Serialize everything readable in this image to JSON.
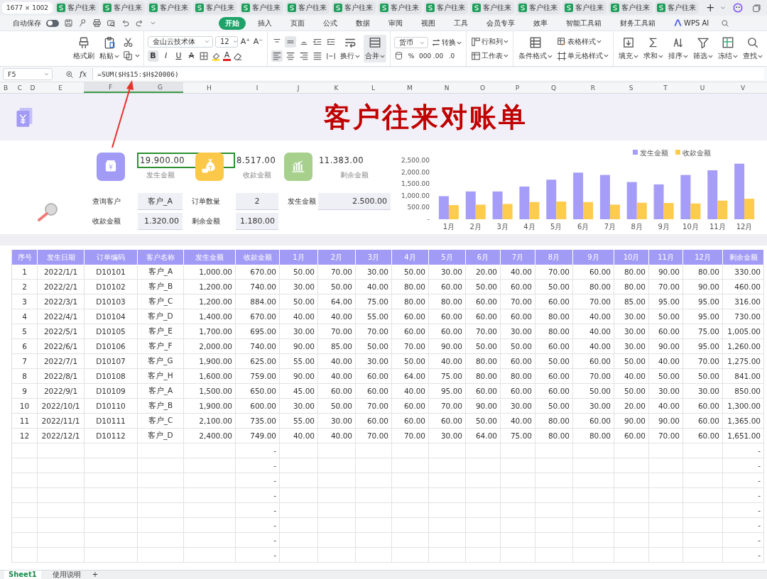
{
  "window_size_badge": "1677 × 1002",
  "doc_tabs": [
    {
      "label": "客户往来",
      "selected": false
    },
    {
      "label": "客户往来",
      "selected": false
    },
    {
      "label": "客户往来",
      "selected": false
    },
    {
      "label": "客户往来",
      "selected": false
    },
    {
      "label": "客户往来",
      "selected": false
    },
    {
      "label": "客户往来",
      "selected": false
    },
    {
      "label": "客户往来",
      "selected": false
    },
    {
      "label": "客户往来",
      "selected": false
    },
    {
      "label": "客户往来",
      "selected": false
    },
    {
      "label": "客户往来",
      "selected": false
    },
    {
      "label": "客户往来",
      "selected": false
    },
    {
      "label": "客户往来",
      "selected": false
    },
    {
      "label": "客户往来",
      "selected": false
    },
    {
      "label": "客户往来",
      "selected": false
    }
  ],
  "new_tab": "+",
  "quick_access": {
    "autosave_label": "自动保存",
    "autosave_on": false
  },
  "menu_tabs": [
    {
      "label": "开始",
      "selected": true,
      "kind": "text"
    },
    {
      "label": "插入",
      "selected": false,
      "kind": "text"
    },
    {
      "label": "页面",
      "selected": false,
      "kind": "text"
    },
    {
      "label": "公式",
      "selected": false,
      "kind": "text"
    },
    {
      "label": "数据",
      "selected": false,
      "kind": "text"
    },
    {
      "label": "审阅",
      "selected": false,
      "kind": "text"
    },
    {
      "label": "视图",
      "selected": false,
      "kind": "text"
    },
    {
      "label": "工具",
      "selected": false,
      "kind": "text"
    },
    {
      "label": "会员专享",
      "selected": false,
      "kind": "text"
    },
    {
      "label": "效率",
      "selected": false,
      "kind": "text"
    },
    {
      "label": "智能工具箱",
      "selected": false,
      "kind": "text"
    },
    {
      "label": "财务工具箱",
      "selected": false,
      "kind": "text"
    },
    {
      "label": "WPS AI",
      "selected": false,
      "kind": "ai"
    }
  ],
  "ribbon": {
    "format_painter": "格式刷",
    "paste": "粘贴",
    "font_family": "金山云技术体",
    "font_size": "12",
    "grow": "A⁺",
    "shrink": "A⁻",
    "format_buttons": [
      {
        "kind": "bold",
        "glyph": "B",
        "on": true
      },
      {
        "kind": "italic",
        "glyph": "I",
        "on": false
      },
      {
        "kind": "underline",
        "glyph": "U",
        "on": false
      },
      {
        "kind": "strike",
        "glyph": "A",
        "on": false
      }
    ],
    "font_color": "A",
    "valign": [
      {
        "kind": "top",
        "on": false
      },
      {
        "kind": "middle",
        "on": true
      },
      {
        "kind": "bottom",
        "on": false
      },
      {
        "kind": "outdent",
        "on": false
      },
      {
        "kind": "indent",
        "on": false
      }
    ],
    "halign": [
      {
        "kind": "left",
        "on": true
      },
      {
        "kind": "center",
        "on": false
      },
      {
        "kind": "right",
        "on": false
      },
      {
        "kind": "justify",
        "on": false
      },
      {
        "kind": "distributed",
        "on": false
      }
    ],
    "wrap": "换行",
    "merge": "合并",
    "number_format": "货币",
    "convert": "转换",
    "number_glyphs": [
      "%",
      "000",
      ".00",
      ".0"
    ],
    "rows_cols": "行和列",
    "worksheet": "工作表",
    "cond_format": "条件格式",
    "table_style": "表格样式",
    "cell_style": "单元格样式",
    "tools": [
      {
        "kind": "fill",
        "label": "填充"
      },
      {
        "kind": "sum",
        "label": "求和"
      },
      {
        "kind": "sort",
        "label": "排序"
      },
      {
        "kind": "filter",
        "label": "筛选"
      },
      {
        "kind": "freeze",
        "label": "冻结"
      },
      {
        "kind": "find",
        "label": "查找"
      }
    ]
  },
  "formula_bar": {
    "cell": "F5",
    "fx": "fx",
    "formula": "=SUM($H$15:$H$20006)"
  },
  "column_headers": [
    {
      "label": "B",
      "selected": false
    },
    {
      "label": "C",
      "selected": false
    },
    {
      "label": "D",
      "selected": false
    },
    {
      "label": "E",
      "selected": false
    },
    {
      "label": "F",
      "selected": true
    },
    {
      "label": "G",
      "selected": true
    },
    {
      "label": "H",
      "selected": false
    },
    {
      "label": "I",
      "selected": false
    },
    {
      "label": "J",
      "selected": false
    },
    {
      "label": "K",
      "selected": false
    },
    {
      "label": "L",
      "selected": false
    },
    {
      "label": "M",
      "selected": false
    },
    {
      "label": "N",
      "selected": false
    },
    {
      "label": "O",
      "selected": false
    },
    {
      "label": "P",
      "selected": false
    },
    {
      "label": "Q",
      "selected": false
    },
    {
      "label": "R",
      "selected": false
    },
    {
      "label": "S",
      "selected": false
    },
    {
      "label": "T",
      "selected": false
    },
    {
      "label": "U",
      "selected": false
    },
    {
      "label": "V",
      "selected": false
    }
  ],
  "dashboard": {
    "title": "客户往来对账单",
    "kpis": [
      {
        "kind": "issued",
        "value": "19.900.00",
        "label": "发生金额",
        "selected": true
      },
      {
        "kind": "received",
        "value": "8.517.00",
        "label": "收款金额",
        "selected": false
      },
      {
        "kind": "remaining",
        "value": "11.383.00",
        "label": "剩余金额",
        "selected": false
      }
    ],
    "query": [
      {
        "label": "查询客户",
        "value": "客户_A",
        "kind": "text"
      },
      {
        "label": "订单数量",
        "value": "2",
        "kind": "text"
      },
      {
        "label": "发生金额",
        "value": "2.500.00",
        "kind": "amount"
      },
      {
        "label": "收款金额",
        "value": "1.320.00",
        "kind": "amount"
      },
      {
        "label": "剩余金额",
        "value": "1.180.00",
        "kind": "amount"
      }
    ],
    "chart_data": {
      "type": "bar",
      "categories": [
        "1月",
        "2月",
        "3月",
        "4月",
        "5月",
        "6月",
        "7月",
        "8月",
        "9月",
        "10月",
        "11月",
        "12月"
      ],
      "series": [
        {
          "name": "发生金额",
          "color": "#a59df7",
          "values": [
            980,
            1180,
            1180,
            1390,
            1680,
            1980,
            1880,
            1580,
            1480,
            1880,
            2080,
            2360
          ]
        },
        {
          "name": "收款金额",
          "color": "#fdcb4d",
          "values": [
            600,
            620,
            650,
            730,
            750,
            730,
            620,
            700,
            690,
            670,
            790,
            870
          ]
        }
      ],
      "legend": "top-right",
      "ylim": [
        0,
        2500
      ],
      "yticks": [
        {
          "value": 0,
          "label": "-"
        },
        {
          "value": 500,
          "label": "500.00"
        },
        {
          "value": 1000,
          "label": "1,000.00"
        },
        {
          "value": 1500,
          "label": "1,500.00"
        },
        {
          "value": 2000,
          "label": "2,000.00"
        },
        {
          "value": 2500,
          "label": "2,500.00"
        }
      ]
    }
  },
  "table": {
    "columns": [
      "序号",
      "发生日期",
      "订单编码",
      "客户名称",
      "发生金额",
      "收款金额",
      "1月",
      "2月",
      "3月",
      "4月",
      "5月",
      "6月",
      "7月",
      "8月",
      "9月",
      "10月",
      "11月",
      "12月",
      "剩余金额"
    ],
    "rows": [
      [
        "1",
        "2022/1/1",
        "D10101",
        "客户_A",
        "1,000.00",
        "670.00",
        "50.00",
        "70.00",
        "30.00",
        "50.00",
        "30.00",
        "20.00",
        "40.00",
        "70.00",
        "60.00",
        "80.00",
        "90.00",
        "80.00",
        "330.00"
      ],
      [
        "2",
        "2022/2/1",
        "D10102",
        "客户_B",
        "1,200.00",
        "740.00",
        "30.00",
        "50.00",
        "40.00",
        "80.00",
        "60.00",
        "50.00",
        "60.00",
        "50.00",
        "80.00",
        "80.00",
        "70.00",
        "90.00",
        "460.00"
      ],
      [
        "3",
        "2022/3/1",
        "D10103",
        "客户_C",
        "1,200.00",
        "884.00",
        "50.00",
        "64.00",
        "75.00",
        "80.00",
        "80.00",
        "60.00",
        "70.00",
        "60.00",
        "70.00",
        "85.00",
        "95.00",
        "95.00",
        "316.00"
      ],
      [
        "4",
        "2022/4/1",
        "D10104",
        "客户_D",
        "1,400.00",
        "670.00",
        "40.00",
        "40.00",
        "55.00",
        "60.00",
        "60.00",
        "60.00",
        "60.00",
        "80.00",
        "40.00",
        "30.00",
        "50.00",
        "95.00",
        "730.00"
      ],
      [
        "5",
        "2022/5/1",
        "D10105",
        "客户_E",
        "1,700.00",
        "695.00",
        "30.00",
        "70.00",
        "70.00",
        "60.00",
        "60.00",
        "70.00",
        "30.00",
        "80.00",
        "40.00",
        "30.00",
        "60.00",
        "75.00",
        "1,005.00"
      ],
      [
        "6",
        "2022/6/1",
        "D10106",
        "客户_F",
        "2,000.00",
        "740.00",
        "90.00",
        "85.00",
        "50.00",
        "70.00",
        "90.00",
        "50.00",
        "50.00",
        "60.00",
        "40.00",
        "30.00",
        "90.00",
        "95.00",
        "1,260.00"
      ],
      [
        "7",
        "2022/7/1",
        "D10107",
        "客户_G",
        "1,900.00",
        "625.00",
        "55.00",
        "40.00",
        "30.00",
        "50.00",
        "40.00",
        "80.00",
        "60.00",
        "50.00",
        "60.00",
        "50.00",
        "40.00",
        "70.00",
        "1,275.00"
      ],
      [
        "8",
        "2022/8/1",
        "D10108",
        "客户_H",
        "1,600.00",
        "759.00",
        "90.00",
        "40.00",
        "60.00",
        "64.00",
        "75.00",
        "80.00",
        "80.00",
        "60.00",
        "70.00",
        "40.00",
        "50.00",
        "50.00",
        "841.00"
      ],
      [
        "9",
        "2022/9/1",
        "D10109",
        "客户_A",
        "1,500.00",
        "650.00",
        "45.00",
        "60.00",
        "60.00",
        "40.00",
        "95.00",
        "60.00",
        "60.00",
        "60.00",
        "50.00",
        "50.00",
        "30.00",
        "30.00",
        "850.00"
      ],
      [
        "10",
        "2022/10/1",
        "D10110",
        "客户_B",
        "1,900.00",
        "600.00",
        "30.00",
        "50.00",
        "70.00",
        "60.00",
        "70.00",
        "90.00",
        "30.00",
        "50.00",
        "30.00",
        "20.00",
        "40.00",
        "60.00",
        "1,300.00"
      ],
      [
        "11",
        "2022/11/1",
        "D10111",
        "客户_C",
        "2,100.00",
        "735.00",
        "55.00",
        "30.00",
        "60.00",
        "60.00",
        "60.00",
        "50.00",
        "40.00",
        "80.00",
        "60.00",
        "90.00",
        "90.00",
        "60.00",
        "1,365.00"
      ],
      [
        "12",
        "2022/12/1",
        "D10112",
        "客户_D",
        "2,400.00",
        "749.00",
        "40.00",
        "40.00",
        "70.00",
        "70.00",
        "30.00",
        "64.00",
        "75.00",
        "80.00",
        "80.00",
        "60.00",
        "70.00",
        "60.00",
        "1,651.00"
      ]
    ],
    "blank_rows": [
      {
        "received": "-",
        "remaining": "-"
      },
      {
        "received": "-",
        "remaining": "-"
      },
      {
        "received": "-",
        "remaining": "-"
      },
      {
        "received": "-",
        "remaining": "-"
      },
      {
        "received": "-",
        "remaining": "-"
      },
      {
        "received": "-",
        "remaining": "-"
      },
      {
        "received": "-",
        "remaining": "-"
      },
      {
        "received": "-",
        "remaining": "-"
      }
    ]
  },
  "sheet_tabs": [
    {
      "label": "Sheet1",
      "selected": true
    },
    {
      "label": "使用说明",
      "selected": false
    }
  ],
  "add_sheet": "+"
}
